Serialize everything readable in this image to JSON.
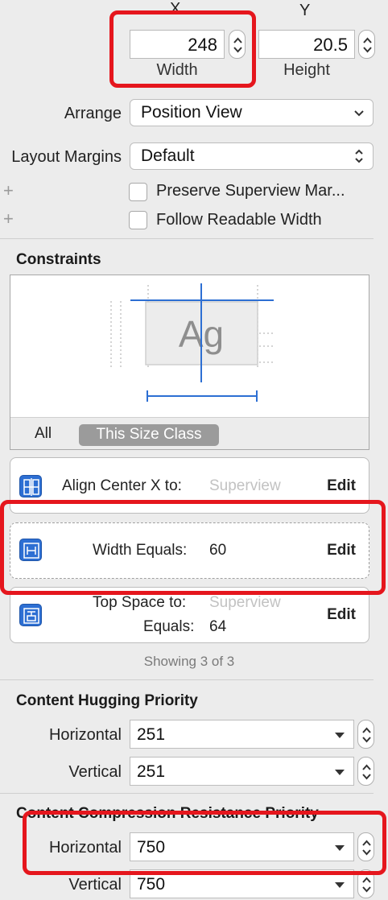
{
  "position": {
    "x_label": "X",
    "y_label": "Y",
    "width_value": "248",
    "width_label": "Width",
    "height_value": "20.5",
    "height_label": "Height"
  },
  "arrange": {
    "label": "Arrange",
    "value": "Position View"
  },
  "layout_margins": {
    "label": "Layout Margins",
    "value": "Default"
  },
  "options": {
    "preserve_superview": "Preserve Superview Mar...",
    "follow_readable": "Follow Readable Width"
  },
  "constraints": {
    "title": "Constraints",
    "preview_text": "Ag",
    "tab_all": "All",
    "tab_size_class": "This Size Class",
    "items": [
      {
        "title": "Align Center X to:",
        "target": "Superview",
        "action": "Edit",
        "icon": "align-center-x-icon"
      },
      {
        "title": "Width Equals:",
        "value": "60",
        "action": "Edit",
        "icon": "width-constraint-icon"
      },
      {
        "title": "Top Space to:",
        "target": "Superview",
        "subtitle": "Equals:",
        "value": "64",
        "action": "Edit",
        "icon": "top-space-icon"
      }
    ],
    "showing": "Showing 3 of 3"
  },
  "hugging": {
    "title": "Content Hugging Priority",
    "horizontal_label": "Horizontal",
    "horizontal_value": "251",
    "vertical_label": "Vertical",
    "vertical_value": "251"
  },
  "compression": {
    "title": "Content Compression Resistance Priority",
    "horizontal_label": "Horizontal",
    "horizontal_value": "750",
    "vertical_label": "Vertical",
    "vertical_value": "750"
  },
  "colors": {
    "accent_blue": "#2d6fd3",
    "highlight_red": "#e5161d",
    "panel_bg": "#ececec"
  }
}
